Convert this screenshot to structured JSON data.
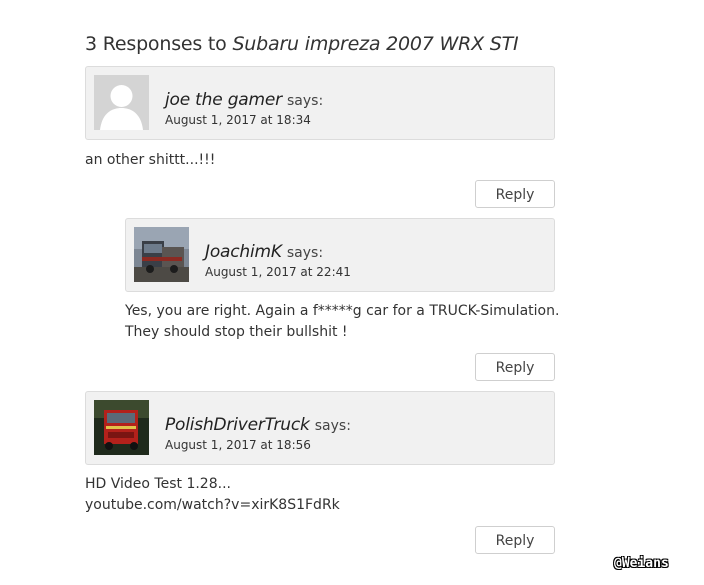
{
  "responses_heading": {
    "prefix": "3 Responses to ",
    "title": "Subaru impreza 2007 WRX STI"
  },
  "comments": [
    {
      "author": "joe the gamer",
      "says": "says:",
      "date": "August 1, 2017 at 18:34",
      "body": [
        "an other shittt...!!!"
      ],
      "reply_label": "Reply",
      "avatar": "default-avatar"
    },
    {
      "author": "JoachimK",
      "says": "says:",
      "date": "August 1, 2017 at 22:41",
      "body": [
        "Yes, you are right. Again a f*****g car for a TRUCK-Simulation.",
        "They should stop their bullshit !"
      ],
      "reply_label": "Reply",
      "avatar": "truck-photo-avatar"
    },
    {
      "author": "PolishDriverTruck",
      "says": "says:",
      "date": "August 1, 2017 at 18:56",
      "body": [
        "HD Video Test 1.28...",
        "youtube.com/watch?v=xirK8S1FdRk"
      ],
      "reply_label": "Reply",
      "avatar": "red-truck-avatar"
    }
  ],
  "watermark": "@Weians"
}
